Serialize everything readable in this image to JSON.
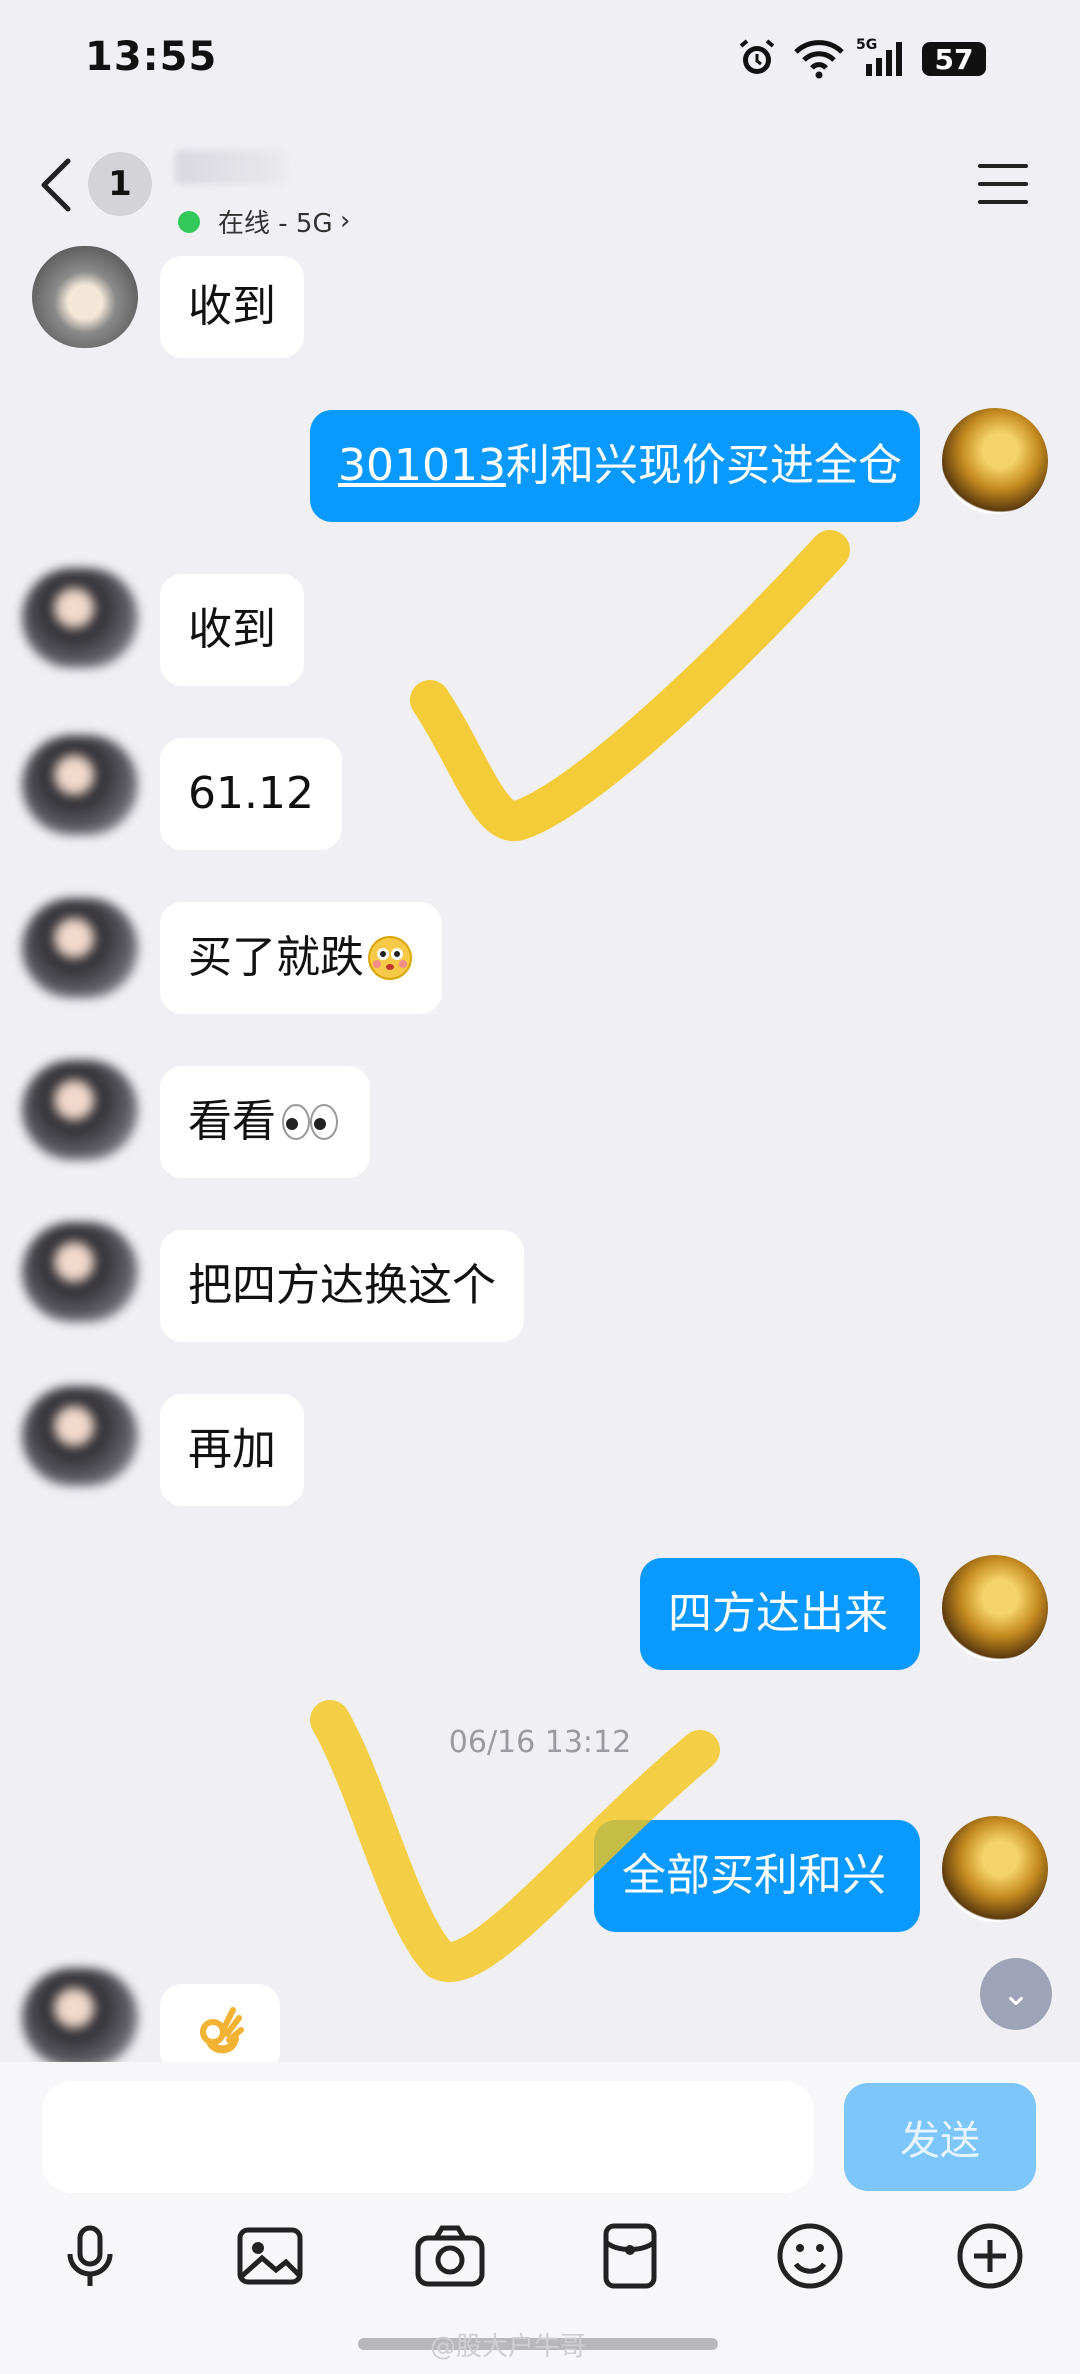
{
  "status_bar": {
    "time": "13:55",
    "battery": "57"
  },
  "header": {
    "unread_count": "1",
    "status": "在线 - 5G"
  },
  "messages": [
    {
      "text": "收到"
    },
    {
      "link_code": "301013",
      "text_rest": "利和兴现价买进全仓"
    },
    {
      "text": "收到"
    },
    {
      "text": "61.12"
    },
    {
      "text": "买了就跌"
    },
    {
      "text": "看看"
    },
    {
      "text": "把四方达换这个"
    },
    {
      "text": "再加"
    },
    {
      "text": "四方达出来"
    },
    {
      "text": "全部买利和兴"
    }
  ],
  "timestamp": "06/16 13:12",
  "input": {
    "placeholder": "",
    "send_label": "发送"
  },
  "toolbar": [
    "microphone-icon",
    "image-icon",
    "camera-icon",
    "red-packet-icon",
    "emoji-icon",
    "plus-icon"
  ],
  "watermark": "@股大户牛哥",
  "colors": {
    "accent": "#0a99ff",
    "background": "#efeff4",
    "check": "#f5c518"
  }
}
